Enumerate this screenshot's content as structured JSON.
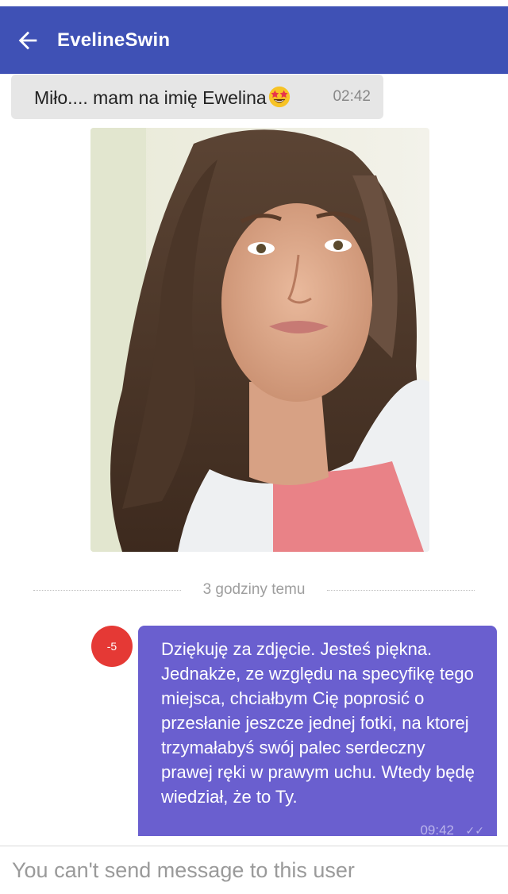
{
  "header": {
    "title": "EvelineSwin",
    "back_icon": "arrow-left-icon",
    "color": "#3f51b5"
  },
  "messages": {
    "incoming": {
      "text": "Miło.... mam na imię Ewelina",
      "emoji": "star-struck-emoji",
      "time": "02:42"
    },
    "photo": {
      "description_icon": "photo-attachment"
    },
    "divider_label": "3 godziny temu",
    "outgoing": {
      "score": "-5",
      "text": "Dziękuję za zdjęcie. Jesteś piękna. Jednakże, ze względu na specyfikę tego miejsca, chciałbym Cię poprosić o przesłanie jeszcze jednej fotki, na ktorej trzymałabyś swój palec serdeczny prawej ręki w prawym uchu. Wtedy będę wiedział, że to Ty.",
      "time": "09:42",
      "ticks": "✓✓",
      "color": "#6a5fcf"
    }
  },
  "composer": {
    "placeholder": "You can't send message to this user"
  }
}
